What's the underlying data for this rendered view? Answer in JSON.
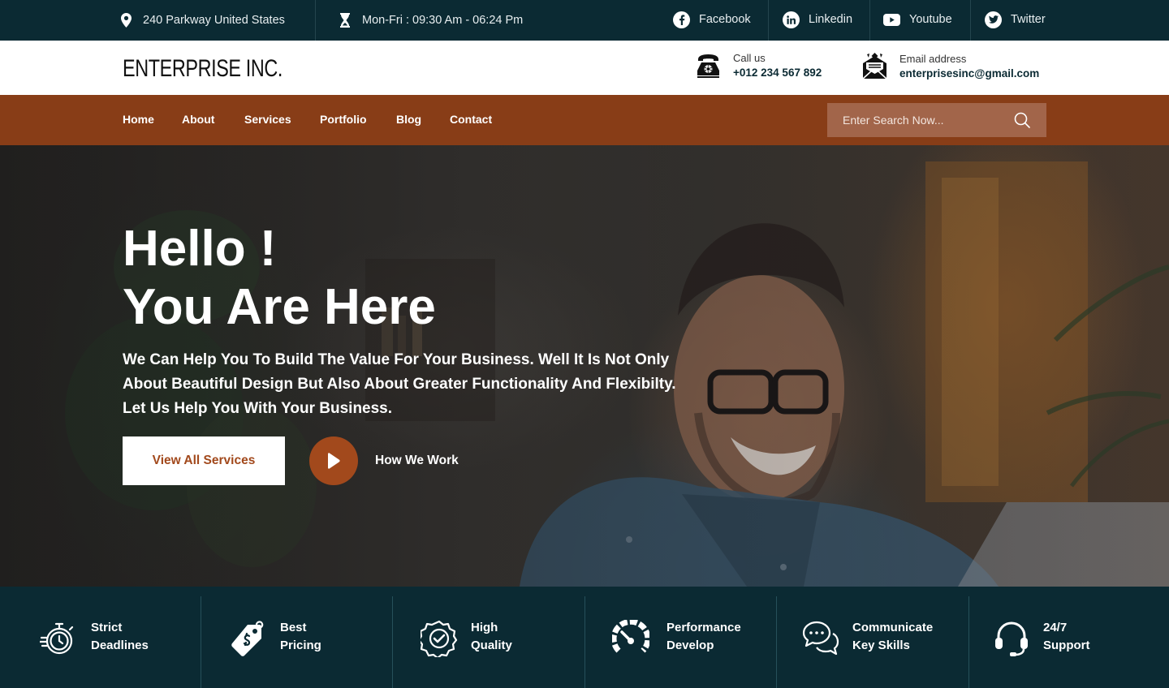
{
  "topbar": {
    "address": "240 Parkway United States",
    "hours": "Mon-Fri : 09:30 Am - 06:24 Pm",
    "social": [
      {
        "label": "Facebook",
        "icon": "facebook-icon"
      },
      {
        "label": "Linkedin",
        "icon": "linkedin-icon"
      },
      {
        "label": "Youtube",
        "icon": "youtube-icon"
      },
      {
        "label": "Twitter",
        "icon": "twitter-icon"
      }
    ]
  },
  "brand": {
    "logo": "ENTERPRISE INC.",
    "call_label": "Call us",
    "call_value": "+012 234 567 892",
    "email_label": "Email address",
    "email_value": "enterprisesinc@gmail.com"
  },
  "nav": {
    "items": [
      "Home",
      "About",
      "Services",
      "Portfolio",
      "Blog",
      "Contact"
    ],
    "search_placeholder": "Enter Search Now..."
  },
  "hero": {
    "title_line1": "Hello !",
    "title_line2": "You Are Here",
    "text_line1": "We Can Help You To Build The Value For Your Business. Well It Is Not Only",
    "text_line2": "About Beautiful Design But Also About Greater Functionality And Flexibilty.",
    "text_line3": "Let Us Help You With Your Business.",
    "primary_button": "View All Services",
    "secondary_link": "How We Work"
  },
  "features": [
    {
      "line1": "Strict",
      "line2": "Deadlines",
      "icon": "stopwatch-icon"
    },
    {
      "line1": "Best",
      "line2": "Pricing",
      "icon": "price-tag-icon"
    },
    {
      "line1": "High",
      "line2": "Quality",
      "icon": "quality-badge-icon"
    },
    {
      "line1": "Performance",
      "line2": "Develop",
      "icon": "speedometer-icon"
    },
    {
      "line1": "Communicate",
      "line2": "Key Skills",
      "icon": "chat-bubbles-icon"
    },
    {
      "line1": "24/7",
      "line2": "Support",
      "icon": "headset-icon"
    }
  ],
  "colors": {
    "dark_teal": "#0b2a33",
    "brown_nav": "#883d17",
    "accent_orange": "#a2491c",
    "search_bg": "#a2654a"
  }
}
